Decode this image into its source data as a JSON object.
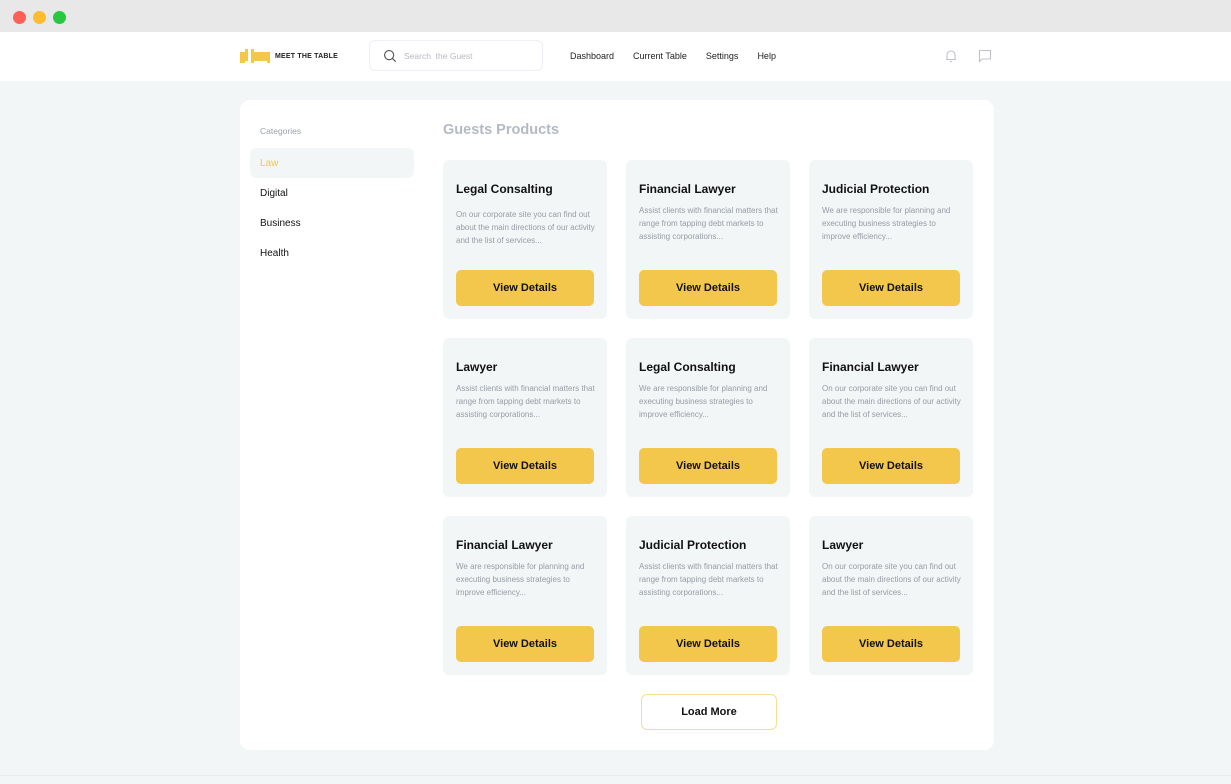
{
  "brand": {
    "name": "MEET THE TABLE",
    "accent_color": "#f3c74c"
  },
  "search": {
    "placeholder": "Search  the Guest",
    "value": ""
  },
  "nav": {
    "links": [
      "Dashboard",
      "Current Table",
      "Settings",
      "Help"
    ],
    "icons": [
      "bell-icon",
      "chat-icon"
    ]
  },
  "sidebar": {
    "title": "Categories",
    "items": [
      {
        "label": "Law",
        "active": true
      },
      {
        "label": "Digital",
        "active": false
      },
      {
        "label": "Business",
        "active": false
      },
      {
        "label": "Health",
        "active": false
      }
    ]
  },
  "main": {
    "title": "Guests Products",
    "cards": [
      {
        "title": "Legal Consalting",
        "description": "On our corporate site you can find out about the main directions of our activity and the list of services...",
        "button": "View Details"
      },
      {
        "title": "Financial Lawyer",
        "description": "Assist clients with financial matters that range from tapping debt markets to assisting corporations...",
        "button": "View Details"
      },
      {
        "title": "Judicial Protection",
        "description": "We are responsible for planning and executing business strategies to improve efficiency...",
        "button": "View Details"
      },
      {
        "title": "Lawyer",
        "description": "Assist clients with financial matters that range from tapping debt markets to assisting corporations...",
        "button": "View Details"
      },
      {
        "title": "Legal Consalting",
        "description": "We are responsible for planning and executing business strategies to improve efficiency...",
        "button": "View Details"
      },
      {
        "title": "Financial Lawyer",
        "description": "On our corporate site you can find out about the main directions of our activity and the list of services...",
        "button": "View Details"
      },
      {
        "title": "Financial Lawyer",
        "description": "We are responsible for planning and executing business strategies to improve efficiency...",
        "button": "View Details"
      },
      {
        "title": "Judicial Protection",
        "description": "Assist clients with financial matters that range from tapping debt markets to assisting corporations...",
        "button": "View Details"
      },
      {
        "title": "Lawyer",
        "description": "On our corporate site you can find out about the main directions of our activity and the list of services...",
        "button": "View Details"
      }
    ],
    "load_more": "Load More"
  }
}
